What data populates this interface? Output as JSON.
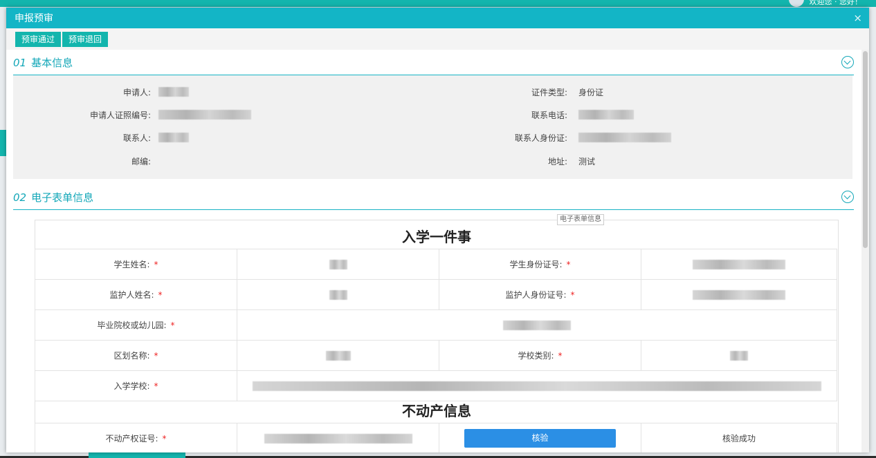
{
  "background": {
    "user_text": "欢迎您 · 您好！"
  },
  "dialog": {
    "title": "申报预审",
    "close_icon": "×",
    "toolbar": {
      "approve_label": "预审通过",
      "reject_label": "预审退回"
    }
  },
  "sections": {
    "basic": {
      "num": "01",
      "title": "基本信息"
    },
    "form": {
      "num": "02",
      "title": "电子表单信息",
      "tag": "电子表单信息"
    }
  },
  "basic_info": {
    "applicant_label": "申请人:",
    "cert_type_label": "证件类型:",
    "cert_type_value": "身份证",
    "applicant_id_label": "申请人证照编号:",
    "phone_label": "联系电话:",
    "contact_label": "联系人:",
    "contact_id_label": "联系人身份证:",
    "postcode_label": "邮编:",
    "address_label": "地址:",
    "address_value": "测试"
  },
  "form": {
    "title1": "入学一件事",
    "student_name_label": "学生姓名:",
    "student_id_label": "学生身份证号:",
    "guardian_name_label": "监护人姓名:",
    "guardian_id_label": "监护人身份证号:",
    "graduated_school_label": "毕业院校或幼儿园:",
    "district_label": "区划名称:",
    "school_type_label": "学校类别:",
    "enroll_school_label": "入学学校:",
    "title2": "不动产信息",
    "property_cert_label": "不动产权证号:",
    "verify_button": "核验",
    "verify_status": "核验成功",
    "required_mark": "*"
  },
  "colors": {
    "accent": "#13b5c6",
    "primary_button": "#2b8fe5",
    "required": "#e22222"
  }
}
